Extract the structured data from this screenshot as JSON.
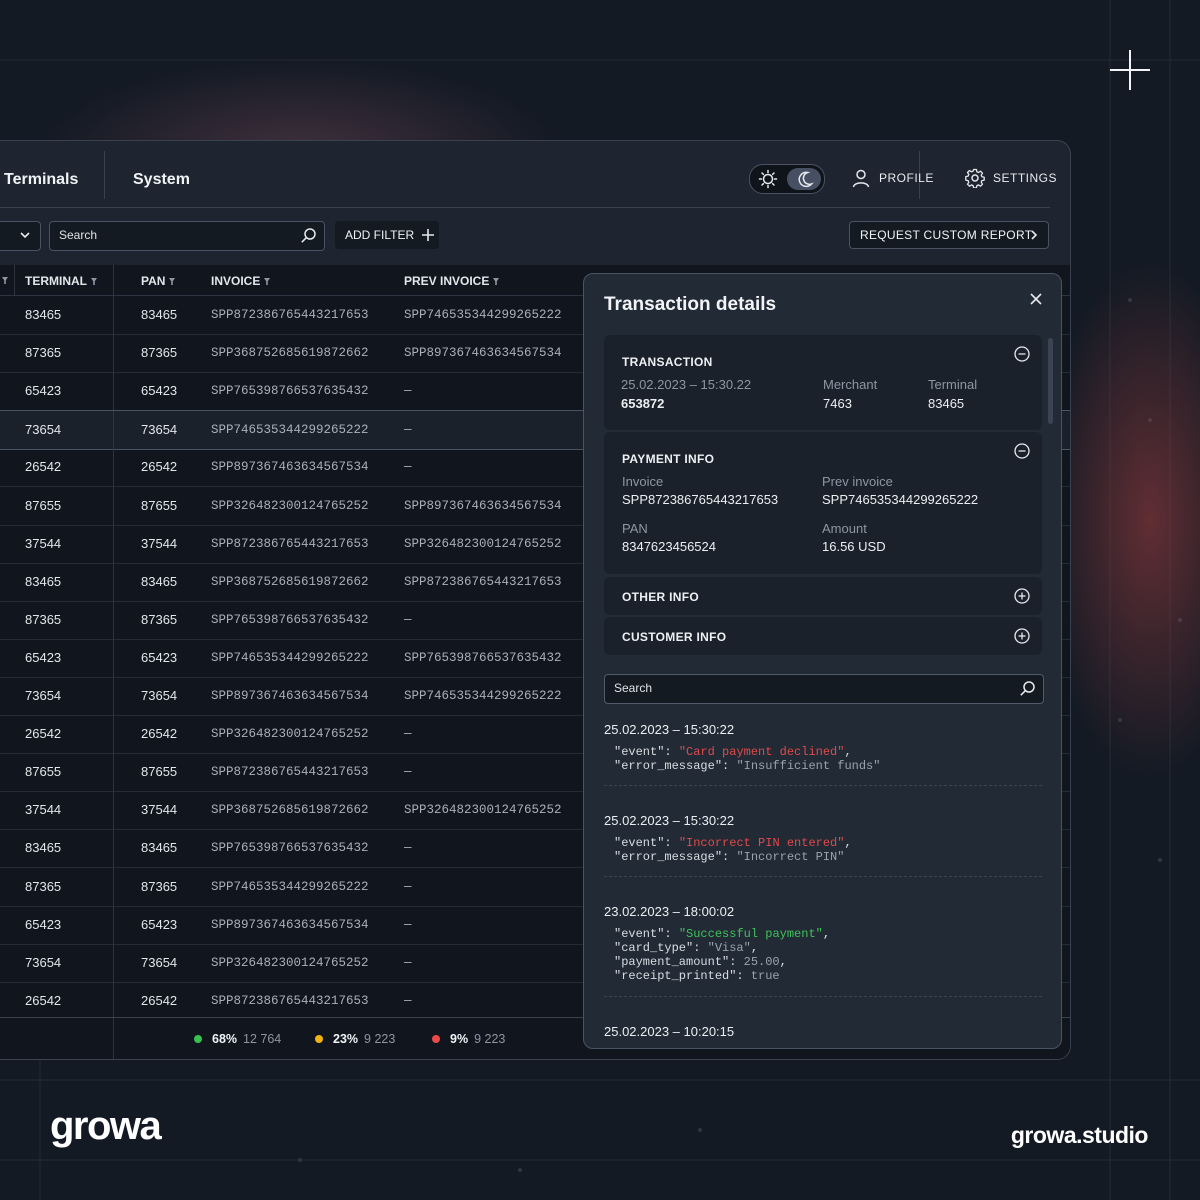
{
  "nav": {
    "items": [
      "Terminals",
      "System"
    ]
  },
  "header": {
    "profile_label": "PROFILE",
    "settings_label": "SETTINGS"
  },
  "filters": {
    "search_placeholder": "Search",
    "add_filter_label": "ADD FILTER",
    "report_label": "REQUEST CUSTOM REPORT"
  },
  "table": {
    "headers": [
      "TERMINAL",
      "PAN",
      "INVOICE",
      "PREV INVOICE"
    ],
    "selected_row": 3,
    "rows": [
      [
        "83465",
        "83465",
        "SPP872386765443217653",
        "SPP746535344299265222"
      ],
      [
        "87365",
        "87365",
        "SPP368752685619872662",
        "SPP897367463634567534"
      ],
      [
        "65423",
        "65423",
        "SPP765398766537635432",
        "—"
      ],
      [
        "73654",
        "73654",
        "SPP746535344299265222",
        "—"
      ],
      [
        "26542",
        "26542",
        "SPP897367463634567534",
        "—"
      ],
      [
        "87655",
        "87655",
        "SPP326482300124765252",
        "SPP897367463634567534"
      ],
      [
        "37544",
        "37544",
        "SPP872386765443217653",
        "SPP326482300124765252"
      ],
      [
        "83465",
        "83465",
        "SPP368752685619872662",
        "SPP872386765443217653"
      ],
      [
        "87365",
        "87365",
        "SPP765398766537635432",
        "—"
      ],
      [
        "65423",
        "65423",
        "SPP746535344299265222",
        "SPP765398766537635432"
      ],
      [
        "73654",
        "73654",
        "SPP897367463634567534",
        "SPP746535344299265222"
      ],
      [
        "26542",
        "26542",
        "SPP326482300124765252",
        "—"
      ],
      [
        "87655",
        "87655",
        "SPP872386765443217653",
        "—"
      ],
      [
        "37544",
        "37544",
        "SPP368752685619872662",
        "SPP326482300124765252"
      ],
      [
        "83465",
        "83465",
        "SPP765398766537635432",
        "—"
      ],
      [
        "87365",
        "87365",
        "SPP746535344299265222",
        "—"
      ],
      [
        "65423",
        "65423",
        "SPP897367463634567534",
        "—"
      ],
      [
        "73654",
        "73654",
        "SPP326482300124765252",
        "—"
      ],
      [
        "26542",
        "26542",
        "SPP872386765443217653",
        "—"
      ]
    ]
  },
  "footer": {
    "stats": [
      {
        "pct": "68%",
        "count": "12 764",
        "color": "#35c24f"
      },
      {
        "pct": "23%",
        "count": "9 223",
        "color": "#f1b316"
      },
      {
        "pct": "9%",
        "count": "9 223",
        "color": "#ea4a4a"
      }
    ]
  },
  "details": {
    "title": "Transaction details",
    "transaction": {
      "title": "TRANSACTION",
      "datetime": "25.02.2023 – 15:30.22",
      "id": "653872",
      "merchant_label": "Merchant",
      "merchant": "7463",
      "terminal_label": "Terminal",
      "terminal": "83465"
    },
    "payment": {
      "title": "PAYMENT INFO",
      "invoice_label": "Invoice",
      "invoice": "SPP872386765443217653",
      "prev_invoice_label": "Prev invoice",
      "prev_invoice": "SPP746535344299265222",
      "pan_label": "PAN",
      "pan": "8347623456524",
      "amount_label": "Amount",
      "amount": "16.56 USD"
    },
    "other_title": "OTHER INFO",
    "customer_title": "CUSTOMER INFO",
    "search_placeholder": "Search",
    "logs": [
      {
        "time": "25.02.2023 – 15:30:22",
        "lines": [
          {
            "key": "\"event\"",
            "value": "\"Card payment declined\"",
            "tone": "red",
            "trail": ","
          },
          {
            "key": "\"error_message\"",
            "value": "\"Insufficient funds\"",
            "tone": "gray",
            "trail": ""
          }
        ]
      },
      {
        "time": "25.02.2023 – 15:30:22",
        "lines": [
          {
            "key": "\"event\"",
            "value": "\"Incorrect PIN entered\"",
            "tone": "red",
            "trail": ","
          },
          {
            "key": "\"error_message\"",
            "value": "\"Incorrect PIN\"",
            "tone": "gray",
            "trail": ""
          }
        ]
      },
      {
        "time": "23.02.2023 – 18:00:02",
        "lines": [
          {
            "key": "\"event\"",
            "value": "\"Successful payment\"",
            "tone": "green",
            "trail": ","
          },
          {
            "key": "\"card_type\"",
            "value": "\"Visa\"",
            "tone": "gray",
            "trail": ","
          },
          {
            "key": "\"payment_amount\"",
            "value": "25.00",
            "tone": "gray",
            "trail": ","
          },
          {
            "key": "\"receipt_printed\"",
            "value": "true",
            "tone": "gray",
            "trail": ""
          }
        ]
      },
      {
        "time": "25.02.2023 – 10:20:15",
        "lines": []
      }
    ]
  },
  "brand": {
    "logo": "growa",
    "site": "growa.studio"
  }
}
